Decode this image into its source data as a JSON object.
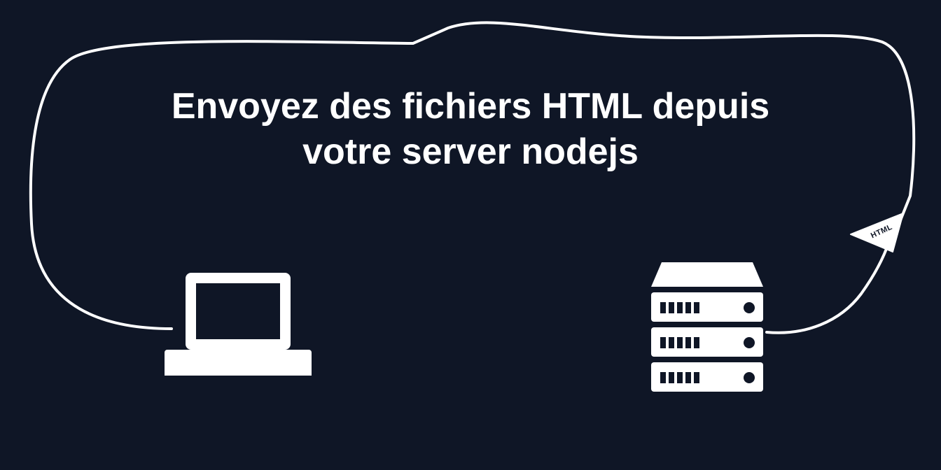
{
  "title_line1": "Envoyez des fichiers HTML depuis",
  "title_line2": "votre server nodejs",
  "badge": "HTML"
}
